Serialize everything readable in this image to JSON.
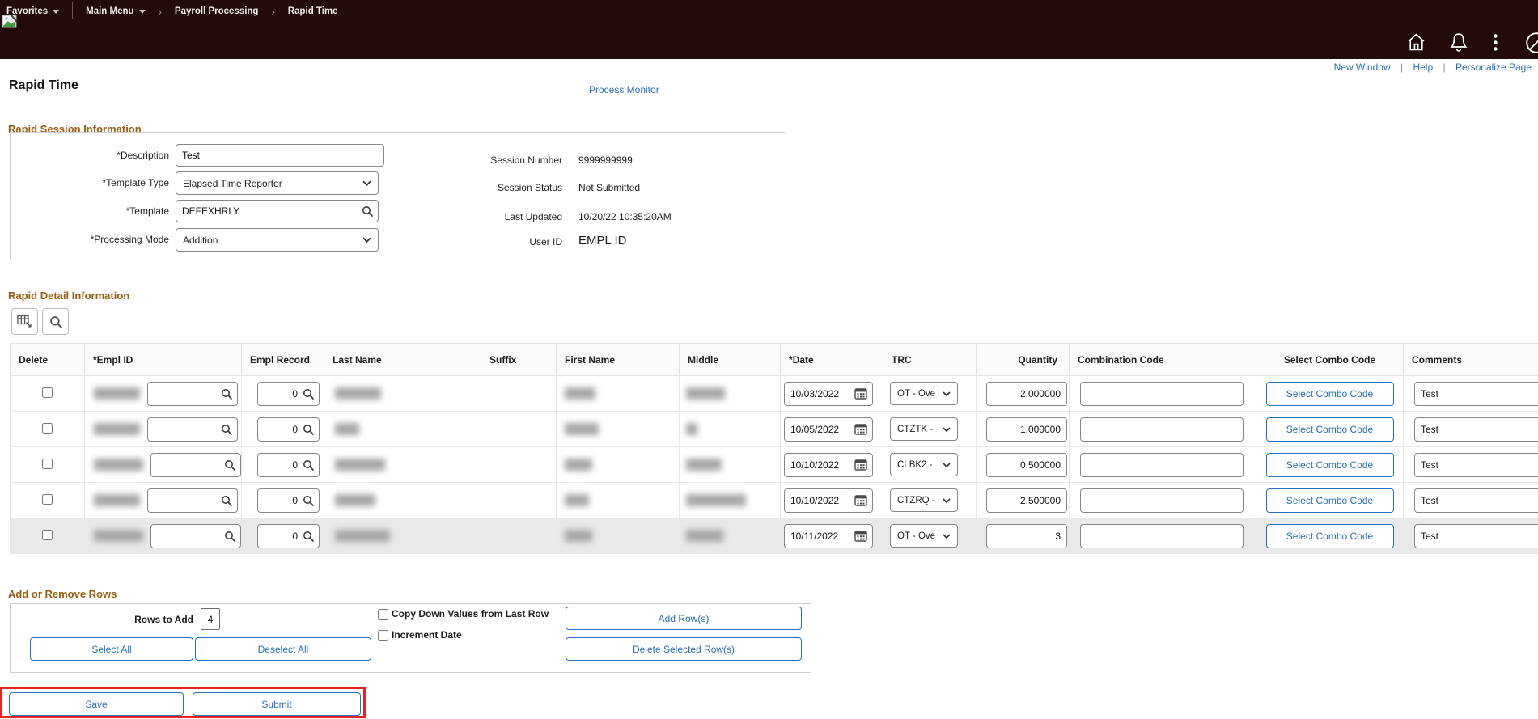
{
  "topbar": {
    "favorites": "Favorites",
    "main_menu": "Main Menu",
    "breadcrumbs": [
      "Payroll Processing",
      "Rapid Time"
    ]
  },
  "utility_links": {
    "new_window": "New Window",
    "help": "Help",
    "personalize_page": "Personalize Page",
    "separator": "|"
  },
  "page": {
    "title": "Rapid Time",
    "process_monitor_link": "Process Monitor"
  },
  "session_info": {
    "heading": "Rapid Session Information",
    "description_label": "*Description",
    "description_value": "Test",
    "template_type_label": "*Template Type",
    "template_type_value": "Elapsed Time Reporter",
    "template_label": "*Template",
    "template_value": "DEFEXHRLY",
    "processing_mode_label": "*Processing Mode",
    "processing_mode_value": "Addition",
    "session_number_label": "Session Number",
    "session_number_value": "9999999999",
    "session_status_label": "Session Status",
    "session_status_value": "Not Submitted",
    "last_updated_label": "Last Updated",
    "last_updated_value": "10/20/22 10:35:20AM",
    "user_id_label": "User ID",
    "user_id_value": "EMPL ID"
  },
  "grid": {
    "heading": "Rapid Detail Information",
    "columns": [
      "Delete",
      "*Empl ID",
      "Empl Record",
      "Last Name",
      "Suffix",
      "First Name",
      "Middle",
      "*Date",
      "TRC",
      "Quantity",
      "Combination Code",
      "Select Combo Code",
      "Comments"
    ],
    "select_combo_button": "Select Combo Code",
    "rows": [
      {
        "empl_record": "0",
        "date": "10/03/2022",
        "trc": "OT - Ove",
        "quantity": "2.000000",
        "combination_code": "",
        "comments": "Test"
      },
      {
        "empl_record": "0",
        "date": "10/05/2022",
        "trc": "CTZTK -",
        "quantity": "1.000000",
        "combination_code": "",
        "comments": "Test"
      },
      {
        "empl_record": "0",
        "date": "10/10/2022",
        "trc": "CLBK2 -",
        "quantity": "0.500000",
        "combination_code": "",
        "comments": "Test"
      },
      {
        "empl_record": "0",
        "date": "10/10/2022",
        "trc": "CTZRQ -",
        "quantity": "2.500000",
        "combination_code": "",
        "comments": "Test"
      },
      {
        "empl_record": "0",
        "date": "10/11/2022",
        "trc": "OT - Ove",
        "quantity": "3",
        "combination_code": "",
        "comments": "Test"
      }
    ]
  },
  "add_remove": {
    "heading": "Add or Remove Rows",
    "rows_to_add_label": "Rows to Add",
    "rows_to_add_value": "4",
    "copy_down_label": "Copy Down Values from Last Row",
    "increment_date_label": "Increment Date",
    "add_rows_button": "Add Row(s)",
    "delete_rows_button": "Delete Selected Row(s)",
    "select_all_button": "Select All",
    "deselect_all_button": "Deselect All"
  },
  "actions": {
    "save_button": "Save",
    "submit_button": "Submit"
  },
  "colors": {
    "link_blue": "#2470c2",
    "heading_brown": "#9c5c10",
    "topbar_bg": "#230b0b",
    "annotation_red": "#e8241e"
  }
}
